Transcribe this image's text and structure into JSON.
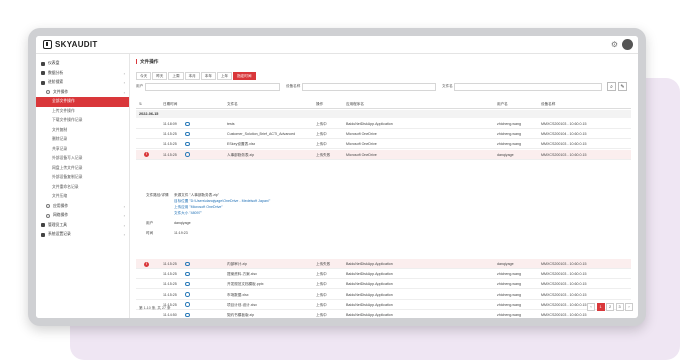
{
  "app": {
    "name": "SKYAUDIT"
  },
  "sidebar": {
    "items": [
      {
        "label": "仪表盘",
        "level": 1,
        "active": false
      },
      {
        "label": "数据分析",
        "level": 1,
        "active": false
      },
      {
        "label": "进阶搜索",
        "level": 1,
        "active": false
      },
      {
        "label": "文件操作",
        "level": 2,
        "active": false
      },
      {
        "label": "全部文件操作",
        "level": 3,
        "active": true
      },
      {
        "label": "上传文件操作",
        "level": 3,
        "active": false
      },
      {
        "label": "下载文件操作记录",
        "level": 3,
        "active": false
      },
      {
        "label": "文件复制",
        "level": 3,
        "active": false
      },
      {
        "label": "删除记录",
        "level": 3,
        "active": false
      },
      {
        "label": "共享记录",
        "level": 3,
        "active": false
      },
      {
        "label": "外部设备写入记录",
        "level": 3,
        "active": false
      },
      {
        "label": "网盘上传文件记录",
        "level": 3,
        "active": false
      },
      {
        "label": "外部设备复制记录",
        "level": 3,
        "active": false
      },
      {
        "label": "文件重命名记录",
        "level": 3,
        "active": false
      },
      {
        "label": "文件压缩",
        "level": 3,
        "active": false
      },
      {
        "label": "应用操作",
        "level": 2,
        "active": false
      },
      {
        "label": "网络操作",
        "level": 2,
        "active": false
      },
      {
        "label": "管理员工具",
        "level": 1,
        "active": false
      },
      {
        "label": "系统设置记录",
        "level": 1,
        "active": false
      }
    ]
  },
  "page": {
    "title": "文件操作"
  },
  "tabs": [
    "今天",
    "昨天",
    "上周",
    "本月",
    "本年",
    "上年",
    "指定时间"
  ],
  "filters": {
    "user_label": "用户",
    "device_label": "设备名称",
    "file_label": "文件名"
  },
  "table": {
    "headers": [
      "日期时间",
      "文件名",
      "操作",
      "应用程序名",
      "用户名",
      "设备名称"
    ],
    "group_date": "2022-06-15",
    "rows_top": [
      {
        "time": "11:18:09",
        "file": "tests",
        "action": "上传中",
        "app": "BaiduNetDiskApp.Application",
        "user": "zhicheng.wang",
        "device": "MMXCS200103 - 10.60.0.15",
        "error": false
      },
      {
        "time": "11:15:25",
        "file": "Customer_Solution_Brief_ACTI_Advanced",
        "action": "上传中",
        "app": "Microsoft OneDrive",
        "user": "zhicheng.wang",
        "device": "MMXCS200104 - 10.60.0.15",
        "error": false
      },
      {
        "time": "11:15:25",
        "file": "ESkey设置表.xlsx",
        "action": "上传中",
        "app": "Microsoft OneDrive",
        "user": "zhicheng.wang",
        "device": "MMXCS200103 - 10.60.0.15",
        "error": false
      },
      {
        "time": "11:15:25",
        "file": "人事部勤务表.zip",
        "action": "上传失败",
        "app": "Microsoft OneDrive",
        "user": "danqiyage",
        "device": "MMXCS200103 - 10.60.0.15",
        "error": true
      }
    ],
    "detail": [
      {
        "label": "文件路径/详情",
        "value": "来源文件 \"人事部勤务表.zip\"",
        "blue": false
      },
      {
        "label": "",
        "value": "目标位置 \"D:\\Users\\danqiyage\\OneDrive - Medelsoft Japan\\\"",
        "blue": true
      },
      {
        "label": "",
        "value": "上传应用 \"Microsoft OneDrive\"",
        "blue": true
      },
      {
        "label": "",
        "value": "文件大小 \"48097\"",
        "blue": true
      },
      {
        "label": "用户",
        "value": "danqiyage",
        "blue": false
      },
      {
        "label": "时间",
        "value": "11:19:23",
        "blue": false
      }
    ],
    "rows_bottom": [
      {
        "time": "11:15:25",
        "file": "内部审计.zip",
        "action": "上传失败",
        "app": "BaiduNetDiskApp.Application",
        "user": "danqiyage",
        "device": "MMXCS200103 - 10.60.0.15",
        "error": true
      },
      {
        "time": "11:15:25",
        "file": "提案资料-方案.xlsx",
        "action": "上传中",
        "app": "BaiduNetDiskApp.Application",
        "user": "zhicheng.wang",
        "device": "MMXCS200103 - 10.60.0.15",
        "error": false
      },
      {
        "time": "11:15:25",
        "file": "开发规范文档模板.pptx",
        "action": "上传中",
        "app": "BaiduNetDiskApp.Application",
        "user": "zhicheng.wang",
        "device": "MMXCS200103 - 10.60.0.15",
        "error": false
      },
      {
        "time": "11:15:25",
        "file": "市场数据.xlsx",
        "action": "上传中",
        "app": "BaiduNetDiskApp.Application",
        "user": "zhicheng.wang",
        "device": "MMXCS200103 - 10.60.0.15",
        "error": false
      },
      {
        "time": "11:15:25",
        "file": "项目计划-设计.xlsx",
        "action": "上传中",
        "app": "BaiduNetDiskApp.Application",
        "user": "zhicheng.wang",
        "device": "MMXCS200103 - 10.60.0.15",
        "error": false
      },
      {
        "time": "11:14:50",
        "file": "契约书模板版.zip",
        "action": "上传中",
        "app": "BaiduNetDiskApp.Application",
        "user": "zhicheng.wang",
        "device": "MMXCS200103 - 10.60.0.15",
        "error": false
      }
    ]
  },
  "pagination": {
    "summary": "第 1-10 条, 共 27 条",
    "pages": [
      "1",
      "2",
      "3"
    ]
  },
  "colors": {
    "accent": "#d9373a"
  }
}
